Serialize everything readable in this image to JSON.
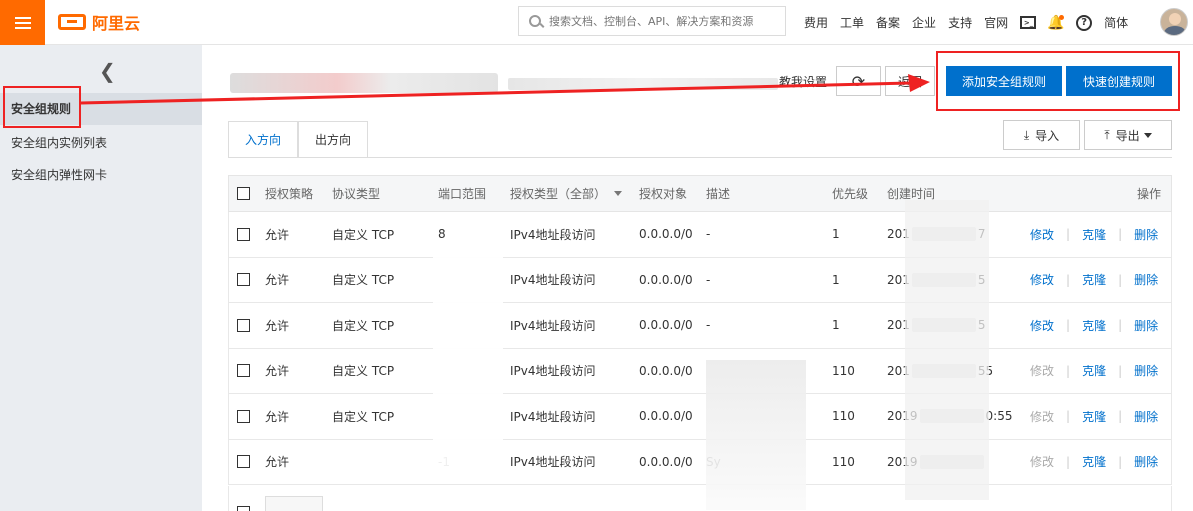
{
  "topbar": {
    "logo_text": "阿里云",
    "search_placeholder": "搜索文档、控制台、API、解决方案和资源",
    "links": [
      "费用",
      "工单",
      "备案",
      "企业",
      "支持",
      "官网"
    ],
    "lang": "简体"
  },
  "sidebar": {
    "items": [
      {
        "label": "安全组规则"
      },
      {
        "label": "安全组内实例列表"
      },
      {
        "label": "安全组内弹性网卡"
      }
    ]
  },
  "toolbar": {
    "teach_label": "教我设置",
    "back_label": "返回",
    "add_rule_label": "添加安全组规则",
    "quick_create_label": "快速创建规则",
    "import_label": "导入",
    "export_label": "导出"
  },
  "tabs": [
    {
      "label": "入方向"
    },
    {
      "label": "出方向"
    }
  ],
  "table": {
    "headers": [
      "授权策略",
      "协议类型",
      "端口范围",
      "授权类型（全部）",
      "授权对象",
      "描述",
      "优先级",
      "创建时间",
      "操作"
    ],
    "actions": {
      "edit": "修改",
      "clone": "克隆",
      "delete": "删除"
    },
    "rows": [
      {
        "policy": "允许",
        "protocol": "自定义 TCP",
        "port": "8",
        "auth_type": "IPv4地址段访问",
        "object": "0.0.0.0/0",
        "desc": "-",
        "priority": "1",
        "time_start": "201",
        "time_end": "7",
        "edit_enabled": true
      },
      {
        "policy": "允许",
        "protocol": "自定义 TCP",
        "port": "",
        "auth_type": "IPv4地址段访问",
        "object": "0.0.0.0/0",
        "desc": "-",
        "priority": "1",
        "time_start": "201",
        "time_end": "5",
        "edit_enabled": true
      },
      {
        "policy": "允许",
        "protocol": "自定义 TCP",
        "port": "",
        "auth_type": "IPv4地址段访问",
        "object": "0.0.0.0/0",
        "desc": "-",
        "priority": "1",
        "time_start": "201",
        "time_end": "5",
        "edit_enabled": true
      },
      {
        "policy": "允许",
        "protocol": "自定义 TCP",
        "port": "",
        "auth_type": "IPv4地址段访问",
        "object": "0.0.0.0/0",
        "desc": "",
        "priority": "110",
        "time_start": "201",
        "time_end": "55",
        "edit_enabled": false
      },
      {
        "policy": "允许",
        "protocol": "自定义 TCP",
        "port": "",
        "auth_type": "IPv4地址段访问",
        "object": "0.0.0.0/0",
        "desc": "",
        "priority": "110",
        "time_start": "2019",
        "time_end": "0:55",
        "edit_enabled": false
      },
      {
        "policy": "允许",
        "protocol": "",
        "port": "-1",
        "auth_type": "IPv4地址段访问",
        "object": "0.0.0.0/0",
        "desc": "Sy",
        "priority": "110",
        "time_start": "2019",
        "time_end": "",
        "edit_enabled": false
      }
    ]
  },
  "colors": {
    "brand": "#ff6a00",
    "primary": "#0070cc",
    "annotation": "#e22222"
  }
}
